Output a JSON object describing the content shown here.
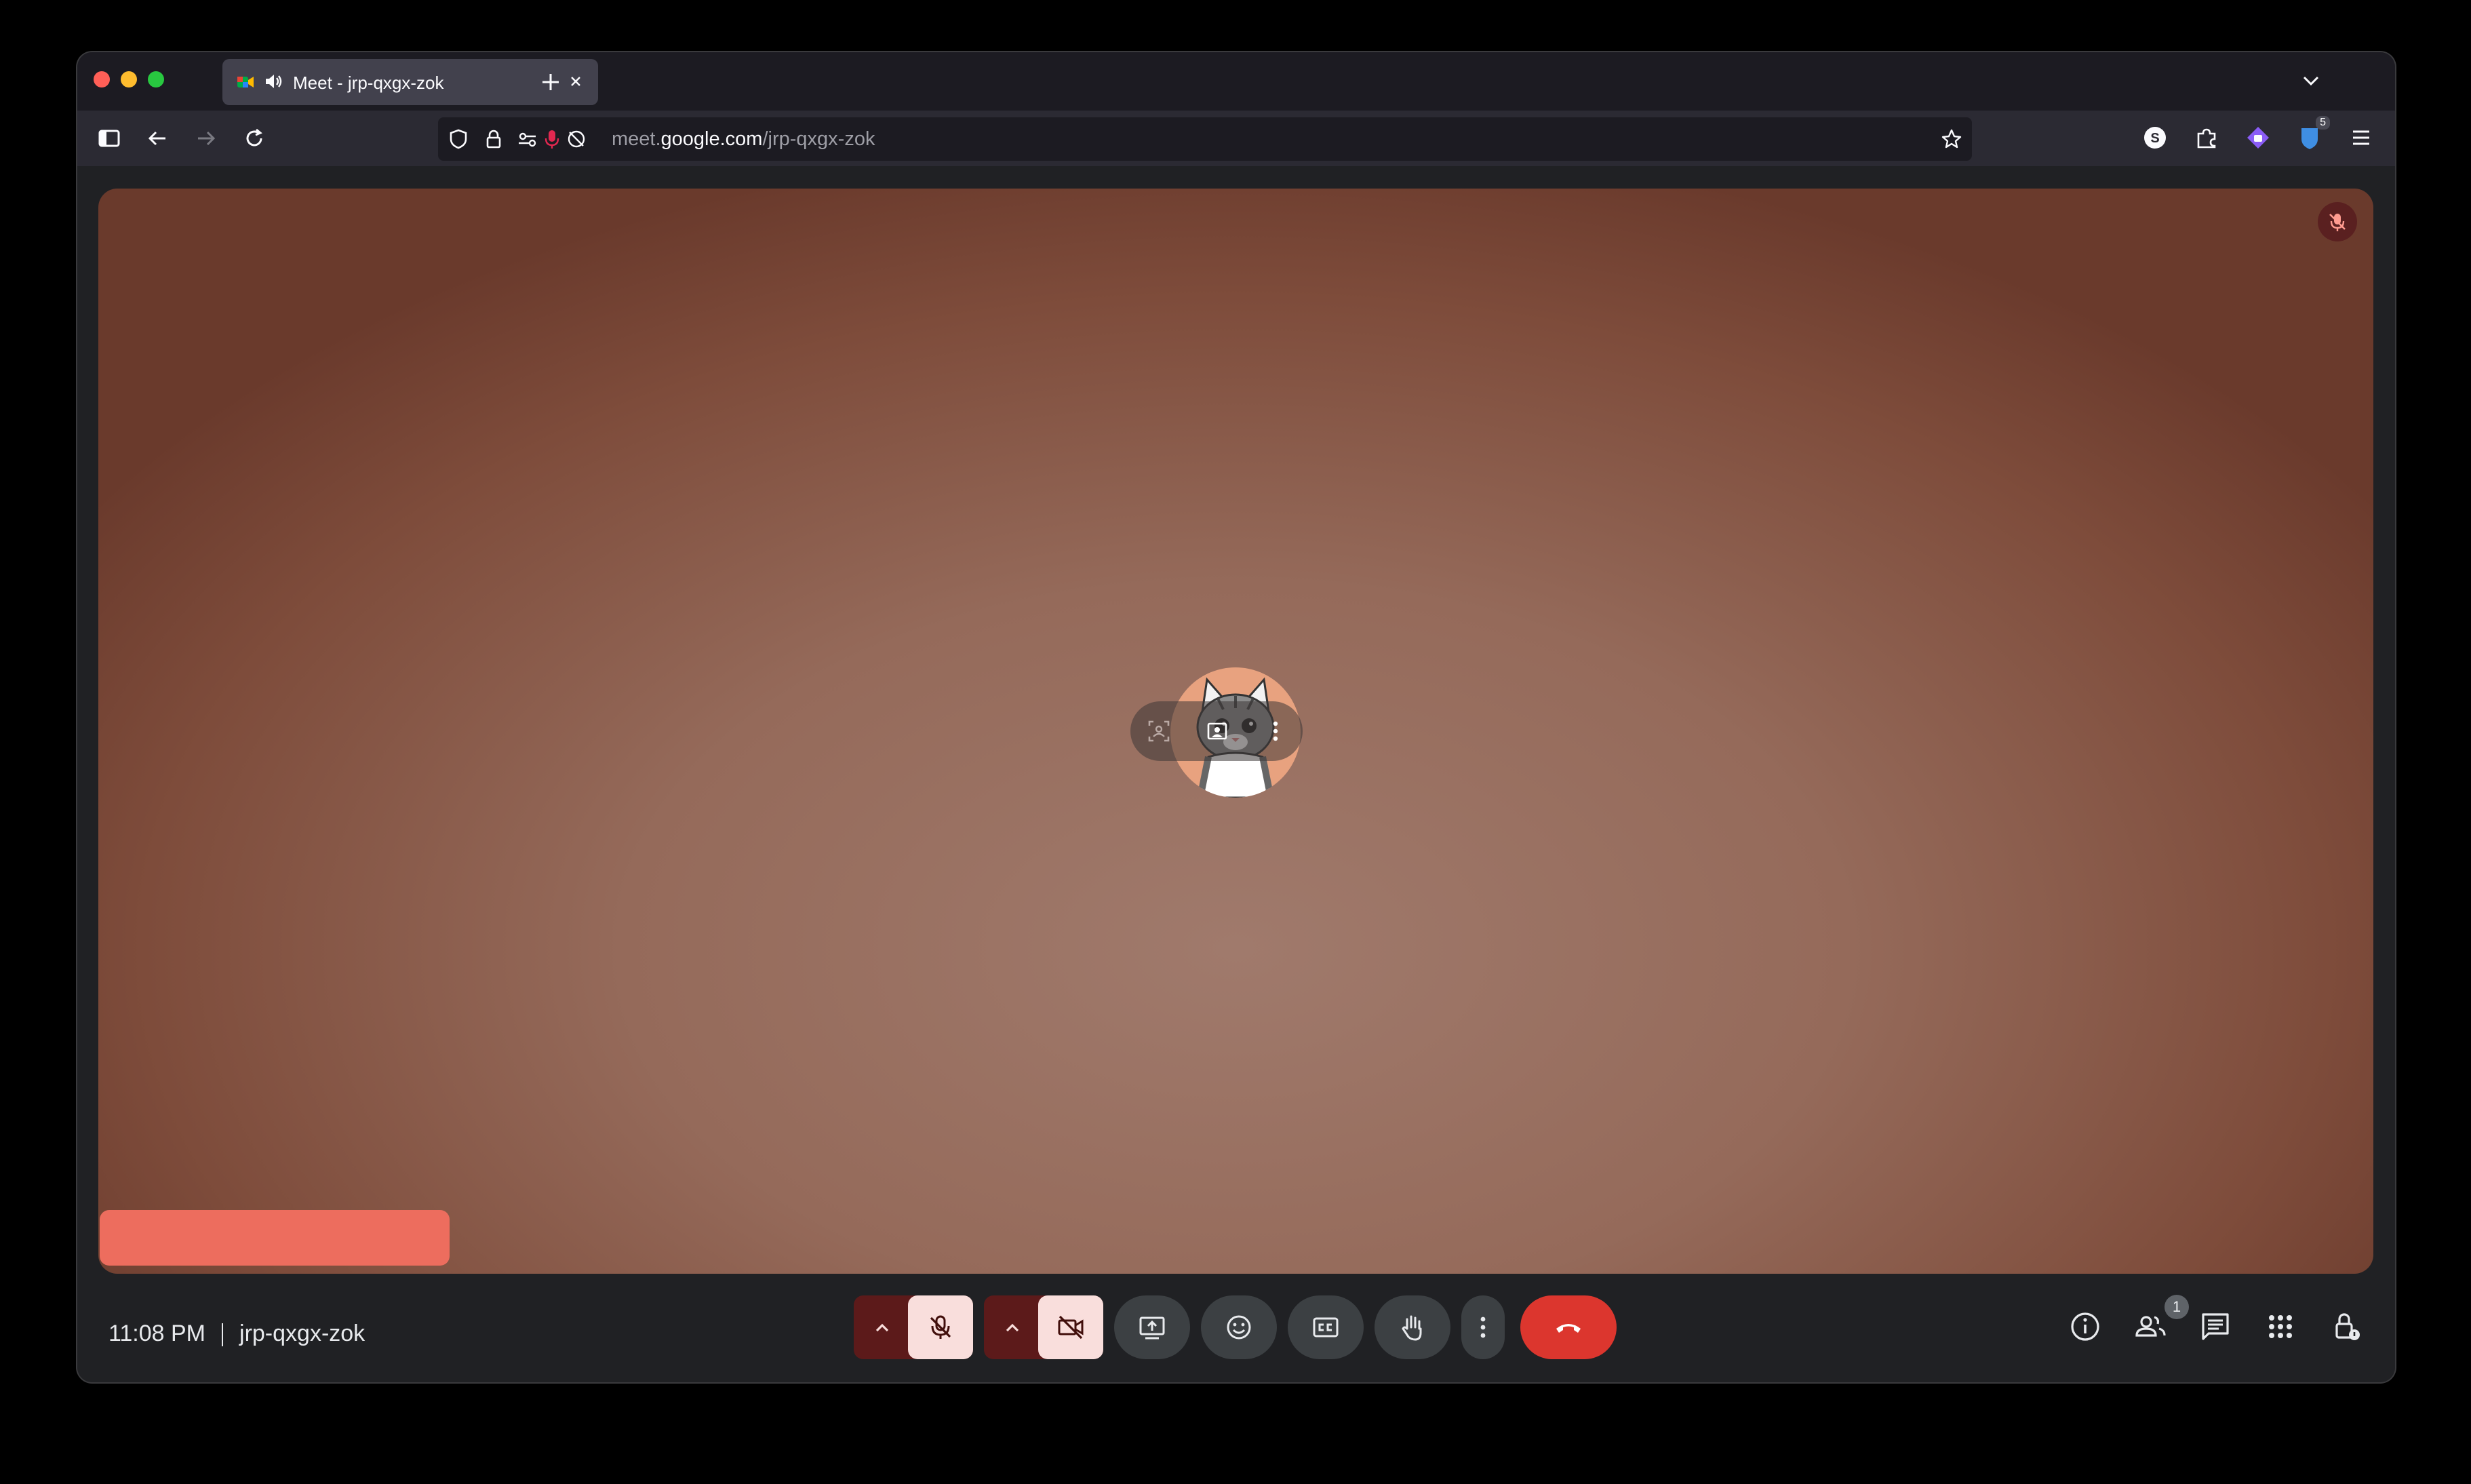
{
  "browser": {
    "tab": {
      "title": "Meet - jrp-qxgx-zok",
      "audio_icon": "speaker-icon",
      "close_icon": "close-icon"
    },
    "url": {
      "subdomain": "meet.",
      "host": "google.com",
      "path": "/jrp-qxgx-zok"
    },
    "extensions": [
      {
        "name": "skype-extension-icon"
      },
      {
        "name": "extensions-puzzle-icon"
      },
      {
        "name": "proton-pass-icon"
      },
      {
        "name": "bitwarden-extension-icon",
        "badge": "5"
      },
      {
        "name": "app-menu-icon"
      }
    ]
  },
  "meet": {
    "time": "11:08 PM",
    "meeting_code": "jrp-qxgx-zok",
    "participants_count": "1",
    "colors": {
      "stage_accent": "#956a5a",
      "name_tag": "#ed6d5e",
      "hangup": "#dc362e",
      "muted_bg": "#5c1a1a"
    }
  }
}
